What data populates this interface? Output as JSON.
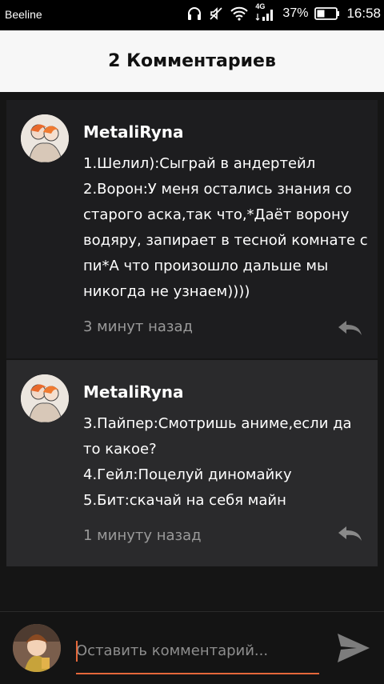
{
  "status_bar": {
    "carrier": "Beeline",
    "network": "4G",
    "battery": "37%",
    "time": "16:58"
  },
  "header": {
    "title": "2 Комментариев"
  },
  "comments": [
    {
      "author": "MetaliRyna",
      "lines": [
        "1.Шелил):Сыграй в андертейл",
        "2.Ворон:У меня остались знания со старого аска,так что,*Даёт ворону водяру, запирает в тесной комнате с пи*А что произошло дальше мы никогда не узнаем))))"
      ],
      "time": "3 минут назад"
    },
    {
      "author": "MetaliRyna",
      "lines": [
        "3.Пайпер:Смотришь аниме,если да то какое?",
        "4.Гейл:Поцелуй диномайку",
        "5.Бит:скачай на себя майн"
      ],
      "time": "1 минуту назад"
    }
  ],
  "composer": {
    "placeholder": "Оставить комментарий..."
  },
  "colors": {
    "accent": "#e4673a",
    "header_bg": "#f7f7f7",
    "bg": "#151515"
  }
}
